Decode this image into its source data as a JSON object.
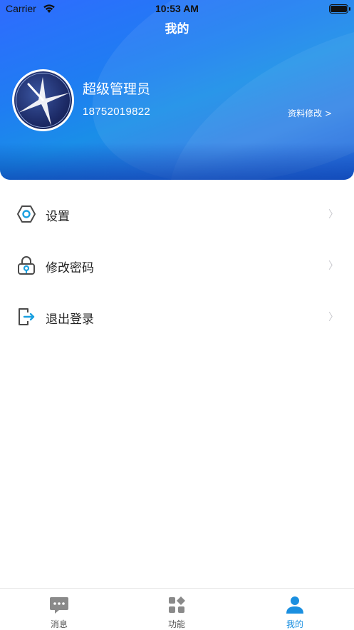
{
  "status_bar": {
    "carrier": "Carrier",
    "time": "10:53 AM"
  },
  "header": {
    "title": "我的",
    "username": "超级管理员",
    "phone": "18752019822",
    "edit_link": "资料修改 >",
    "gradient_colors": [
      "#2f6bff",
      "#1a8ee8",
      "#1560d8"
    ]
  },
  "menu": {
    "items": [
      {
        "label": "设置",
        "icon": "settings-icon",
        "chevron": "〉"
      },
      {
        "label": "修改密码",
        "icon": "lock-icon",
        "chevron": "〉"
      },
      {
        "label": "退出登录",
        "icon": "logout-icon",
        "chevron": "〉"
      }
    ]
  },
  "tabbar": {
    "tabs": [
      {
        "label": "消息",
        "icon": "message-icon",
        "active": false
      },
      {
        "label": "功能",
        "icon": "apps-icon",
        "active": false
      },
      {
        "label": "我的",
        "icon": "user-icon",
        "active": true
      }
    ],
    "active_color": "#1a8fe0",
    "inactive_color": "#6b6b6b"
  }
}
